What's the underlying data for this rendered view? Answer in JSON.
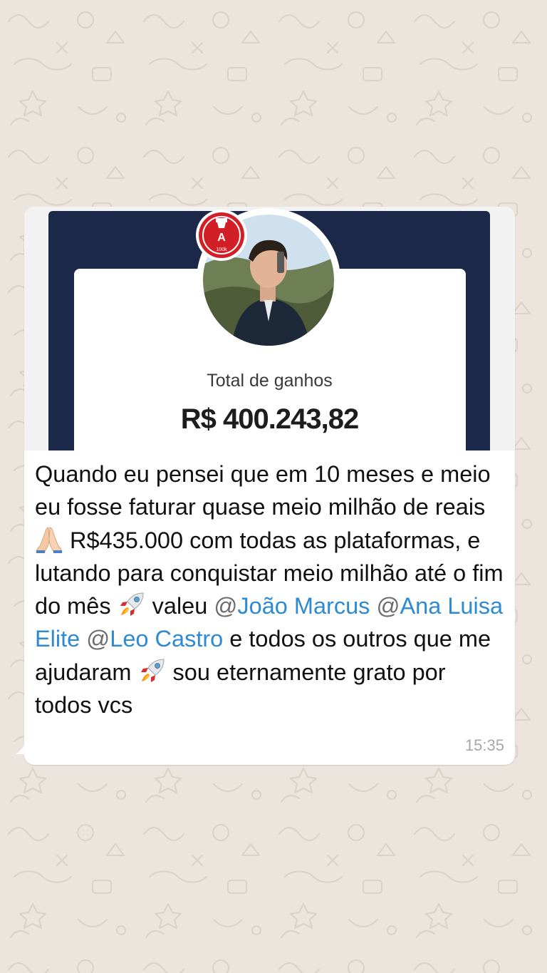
{
  "chat": {
    "wallpaper_color": "#ece5dd",
    "bubble_color": "#ffffff"
  },
  "screenshot": {
    "label": "Total de ganhos",
    "amount": "R$ 400.243,82",
    "badge_letter": "A",
    "badge_caption": "100k",
    "header_color": "#1b2849",
    "badge_color": "#d21f27"
  },
  "message": {
    "part1": "Quando eu pensei que em 10 meses e meio eu fosse faturar quase meio milhão de reais ",
    "emoji1": "folded-hands-icon",
    "part2": " R$435.000 com todas as plataformas, e lutando para conquistar meio milhão até o fim do mês ",
    "emoji2": "rocket-icon",
    "part3": " valeu ",
    "mention1_at": "@",
    "mention1": "João Marcus",
    "mention2_at": "@",
    "mention2": "Ana Luisa Elite",
    "mention3_at": "@",
    "mention3": "Leo Castro",
    "part4": " e todos os outros que me ajudaram ",
    "emoji3": "rocket-icon",
    "part5": " sou eternamente grato por todos vcs",
    "time": "15:35",
    "mention_color": "#2d8ad3"
  }
}
